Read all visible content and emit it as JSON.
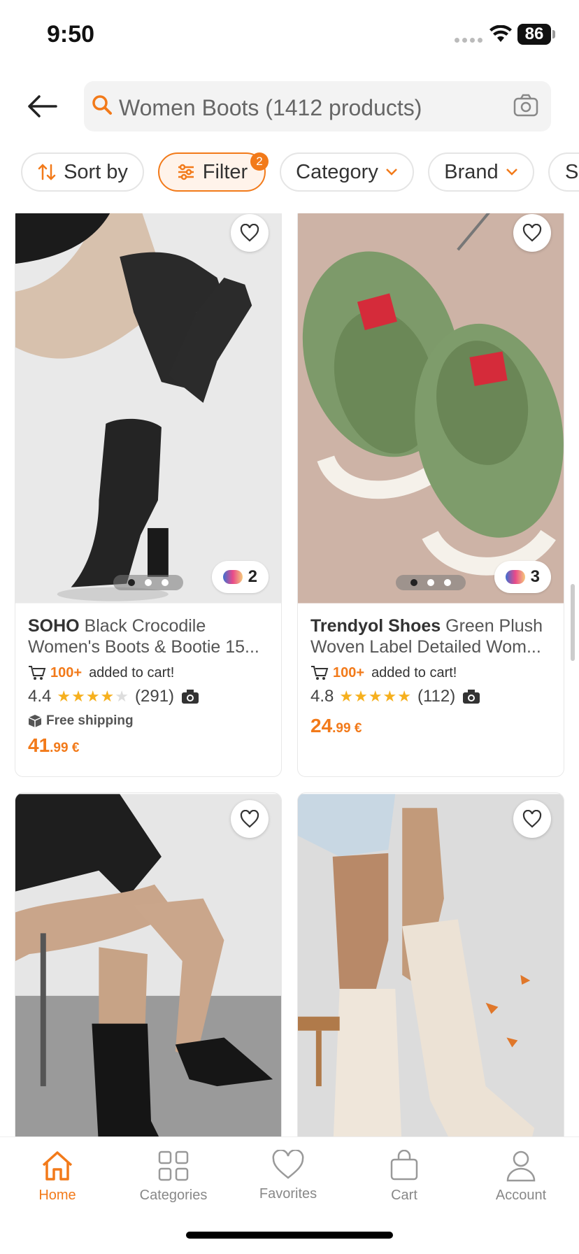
{
  "status": {
    "time": "9:50",
    "battery": "86"
  },
  "search": {
    "query": "Women Boots (1412 products)"
  },
  "filters": {
    "sort_label": "Sort by",
    "filter_label": "Filter",
    "filter_badge": "2",
    "category_label": "Category",
    "brand_label": "Brand",
    "size_label": "Si"
  },
  "products": [
    {
      "brand": "SOHO",
      "name": "Black Crocodile Women's Boots & Bootie 15...",
      "cart_count": "100+",
      "cart_text": "added to cart!",
      "rating": "4.4",
      "reviews": "(291)",
      "shipping": "Free shipping",
      "price_main": "41",
      "price_cents": ".99 €",
      "colors": "2"
    },
    {
      "brand": "Trendyol Shoes",
      "name": "Green Plush Woven Label Detailed Wom...",
      "cart_count": "100+",
      "cart_text": "added to cart!",
      "rating": "4.8",
      "reviews": "(112)",
      "price_main": "24",
      "price_cents": ".99 €",
      "colors": "3"
    }
  ],
  "tabs": {
    "home": "Home",
    "categories": "Categories",
    "favorites": "Favorites",
    "cart": "Cart",
    "account": "Account"
  },
  "colors": {
    "accent": "#f27a1a"
  }
}
